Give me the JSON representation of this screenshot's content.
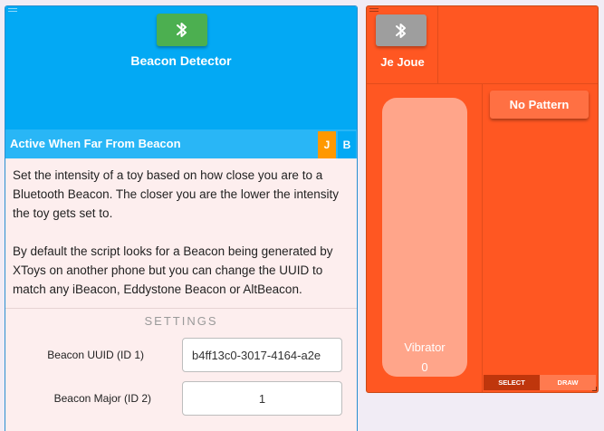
{
  "beacon_panel": {
    "title": "Beacon Detector",
    "bluetooth_button_icon": "bluetooth-icon",
    "bluetooth_button_color": "#4caf50",
    "header_color": "#03a9f4",
    "script": {
      "title": "Active When Far From Beacon",
      "tag_j": "J",
      "tag_b": "B",
      "description": [
        "Set the intensity of a toy based on how close you are to a Bluetooth Beacon. The closer you are the lower the intensity the toy gets set to.",
        "By default the script looks for a Beacon being generated by XToys on another phone but you can change the UUID to match any iBeacon, Eddystone Beacon or AltBeacon."
      ]
    },
    "settings": {
      "heading": "SETTINGS",
      "uuid_label": "Beacon UUID (ID 1)",
      "uuid_value": "b4ff13c0-3017-4164-a2e",
      "major_label": "Beacon Major (ID 2)",
      "major_value": "1"
    }
  },
  "toy_panel": {
    "title": "Je Joue",
    "bluetooth_button_icon": "bluetooth-icon",
    "bluetooth_button_color": "#9e9e9e",
    "panel_color": "#ff5722",
    "vibrator": {
      "label": "Vibrator",
      "value": "0"
    },
    "pattern_button": "No Pattern",
    "mode_select": "SELECT",
    "mode_draw": "DRAW"
  }
}
